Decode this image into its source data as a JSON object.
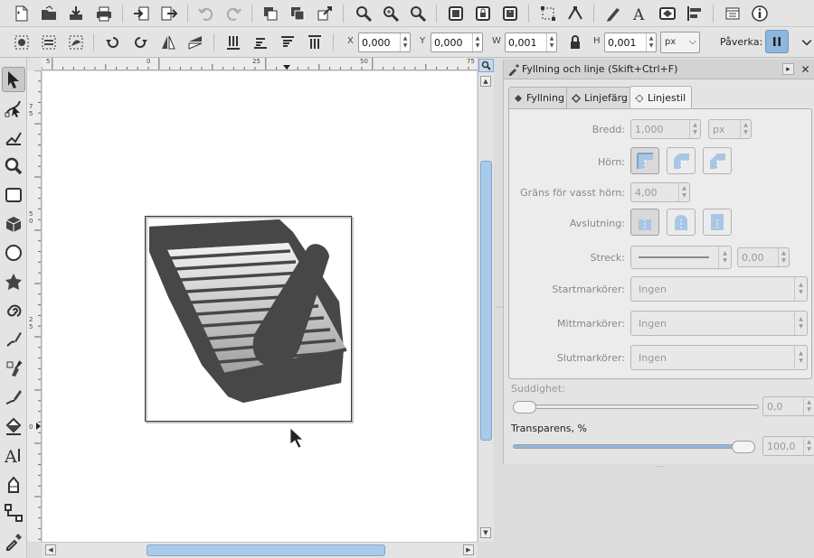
{
  "toolbar": {
    "x_label": "X",
    "x_value": "0,000",
    "y_label": "Y",
    "y_value": "0,000",
    "w_label": "W",
    "w_value": "0,001",
    "h_label": "H",
    "h_value": "0,001",
    "unit": "px",
    "affect_label": "Påverka:"
  },
  "ruler": {
    "top_ticks": [
      "5",
      "0",
      "25",
      "50",
      "75"
    ],
    "left_ticks": [
      "7",
      "5",
      "5",
      "0",
      "2",
      "5",
      "0"
    ]
  },
  "dock": {
    "title": "Fyllning och linje (Skift+Ctrl+F)",
    "tabs": [
      {
        "label": "Fyllning"
      },
      {
        "label": "Linjefärg"
      },
      {
        "label": "Linjestil"
      }
    ],
    "width_label": "Bredd:",
    "width_value": "1,000",
    "width_unit": "px",
    "join_label": "Hörn:",
    "miter_label": "Gräns för vasst hörn:",
    "miter_value": "4,00",
    "cap_label": "Avslutning:",
    "dash_label": "Streck:",
    "dash_value": "0,00",
    "start_marker_label": "Startmarkörer:",
    "start_marker_value": "Ingen",
    "mid_marker_label": "Mittmarkörer:",
    "mid_marker_value": "Ingen",
    "end_marker_label": "Slutmarkörer:",
    "end_marker_value": "Ingen",
    "blur_label": "Suddighet:",
    "blur_value": "0,0",
    "blur_fraction": 0.0,
    "opacity_label": "Transparens, %",
    "opacity_value": "100,0",
    "opacity_fraction": 1.0
  },
  "colors": {
    "accent": "#8fb7dc",
    "scroll_thumb": "#a9cbe9",
    "artwork_dark": "#474747"
  }
}
